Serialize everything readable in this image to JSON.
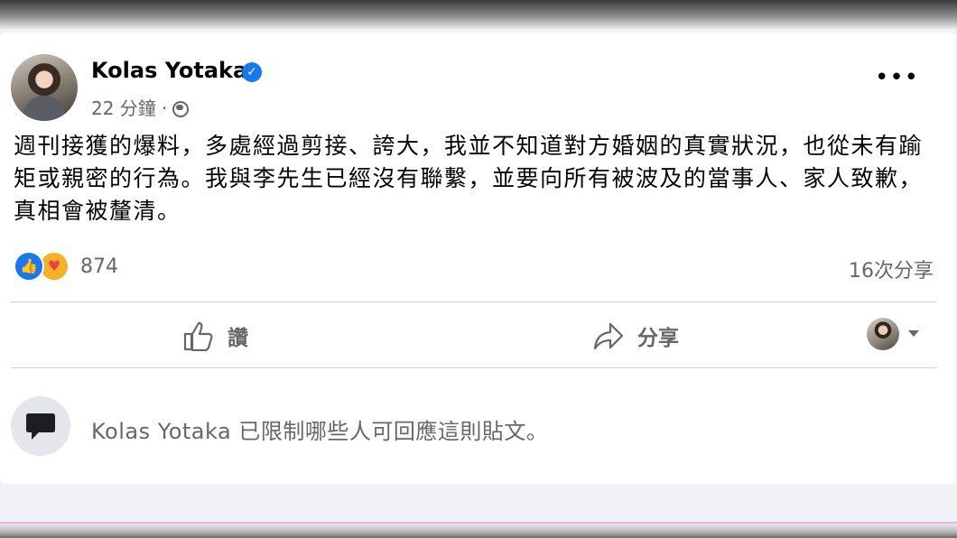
{
  "post": {
    "author": "Kolas Yotaka",
    "timestamp": "22 分鐘",
    "separator": "·",
    "visibility_icon": "globe-icon",
    "body": "週刊接獲的爆料，多處經過剪接、誇大，我並不知道對方婚姻的真實狀況，也從未有踰矩或親密的行為。我與李先生已經沒有聯繫，並要向所有被波及的當事人、家人致歉，真相會被釐清。",
    "reaction_count": "874",
    "share_count": "16次分享"
  },
  "actions": {
    "like_label": "讚",
    "share_label": "分享"
  },
  "comments": {
    "restricted_notice": "Kolas Yotaka 已限制哪些人可回應這則貼文。"
  },
  "colors": {
    "accent": "#1877f2",
    "secondary_text": "#65676b",
    "divider": "#ced0d4"
  }
}
